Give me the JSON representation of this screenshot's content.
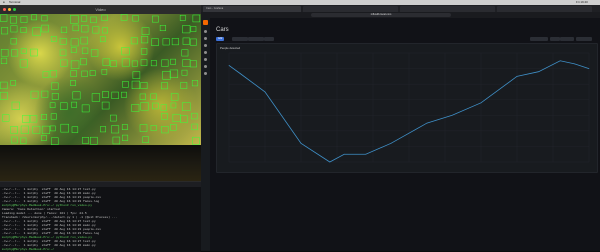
{
  "menubar": {
    "app": "Terminal",
    "clock": "Fri 19:40"
  },
  "video": {
    "title": "Video"
  },
  "terminal": {
    "lines": [
      "-rw-r--r--  1 murphy  staff  20 Aug 16 14:27 test.py",
      "-rw-r--r--  1 murphy  staff  20 Aug 16 14:26 main.py",
      "-rw-r--r--  1 murphy  staff  20 Aug 16 14:23 people.csv",
      "-rw-r--r--  1 murphy  staff  20 Aug 16 14:23 faces.log",
      "murphy@Murphys-MacBook-Pro:~/ python3 run_video.py",
      "Camera: 'Face Detection' started",
      "Loading model ... done | faces: 161 | fps: 24.5",
      "Traceback: /Users/murphy/.../detect.py 1 | -1 (Quit Process) ...",
      "-rw-r--r--  1 murphy  staff  20 Aug 16 14:27 test.py",
      "-rw-r--r--  1 murphy  staff  20 Aug 16 14:26 main.py",
      "-rw-r--r--  1 murphy  staff  20 Aug 16 14:23 people.csv",
      "-rw-r--r--  1 murphy  staff  20 Aug 16 14:23 faces.log",
      "murphy@Murphys-MacBook-Pro:~/ python3 run_video.py",
      "-rw-r--r--  1 murphy  staff  20 Aug 16 14:27 test.py",
      "-rw-r--r--  1 murphy  staff  20 Aug 16 14:26 main.py",
      "murphy@Murphys-MacBook-Pro:~/"
    ]
  },
  "browser": {
    "tabs": [
      "Cars - Grafana",
      "",
      "",
      ""
    ],
    "url": "influxdb.local.com"
  },
  "grafana": {
    "dashboard_title": "Cars",
    "buttons": {
      "add": "Add",
      "b2": "",
      "b3": "",
      "time_range": ""
    },
    "panel_title": "People detected"
  },
  "colors": {
    "series": "#3f90c8",
    "accent": "#3d71d9",
    "grafana_orange": "#f46800",
    "bg": "#111217"
  },
  "chart_data": {
    "type": "line",
    "title": "People detected",
    "series": [
      {
        "x": [
          0.0,
          0.03,
          0.1,
          0.2,
          0.28,
          0.32,
          0.38,
          0.45,
          0.55,
          0.62,
          0.7,
          0.8,
          0.86,
          0.92,
          0.96,
          1.0
        ],
        "y": [
          62,
          57,
          45,
          12,
          0,
          5,
          5,
          12,
          25,
          30,
          38,
          55,
          58,
          65,
          63,
          60
        ]
      }
    ],
    "xlim": [
      0,
      1
    ],
    "ylim": [
      0,
      70
    ],
    "grid": true,
    "legend": "none"
  }
}
